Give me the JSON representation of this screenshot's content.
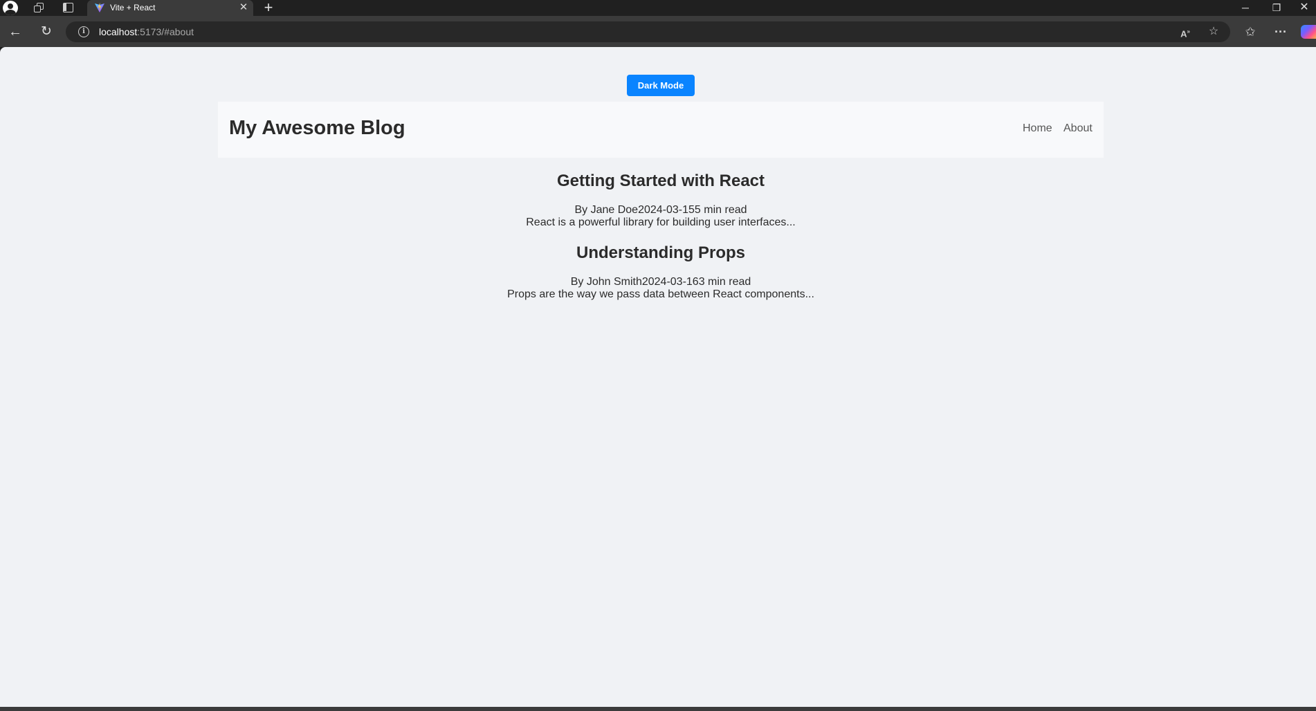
{
  "browser": {
    "tab": {
      "title": "Vite + React"
    },
    "address": {
      "host": "localhost",
      "path": ":5173/#about"
    },
    "icons": {
      "profile": "profile-icon",
      "collections": "collections-icon",
      "tab_actions": "tab-actions-icon",
      "tab_logo": "vite-logo-icon",
      "close_tab": "close-icon",
      "new_tab": "plus-icon",
      "minimize": "minimize-icon",
      "restore": "restore-icon",
      "close_window": "close-icon",
      "back": "back-arrow-icon",
      "refresh": "refresh-icon",
      "site_info": "info-icon",
      "read_aloud": "read-aloud-icon",
      "favorite": "star-icon",
      "favorites_bar": "favorites-icon",
      "more": "more-icon",
      "copilot": "copilot-icon"
    }
  },
  "page": {
    "theme_toggle_label": "Dark Mode",
    "header": {
      "title": "My Awesome Blog",
      "nav": [
        {
          "label": "Home"
        },
        {
          "label": "About"
        }
      ]
    },
    "posts": [
      {
        "title": "Getting Started with React",
        "meta": "By Jane Doe2024-03-155 min read",
        "excerpt": "React is a powerful library for building user interfaces..."
      },
      {
        "title": "Understanding Props",
        "meta": "By John Smith2024-03-163 min read",
        "excerpt": "Props are the way we pass data between React components..."
      }
    ]
  },
  "colors": {
    "accent": "#0a84ff",
    "page_background": "#f0f2f5",
    "header_background": "#f8f9fb",
    "text": "#2b2b2b"
  }
}
